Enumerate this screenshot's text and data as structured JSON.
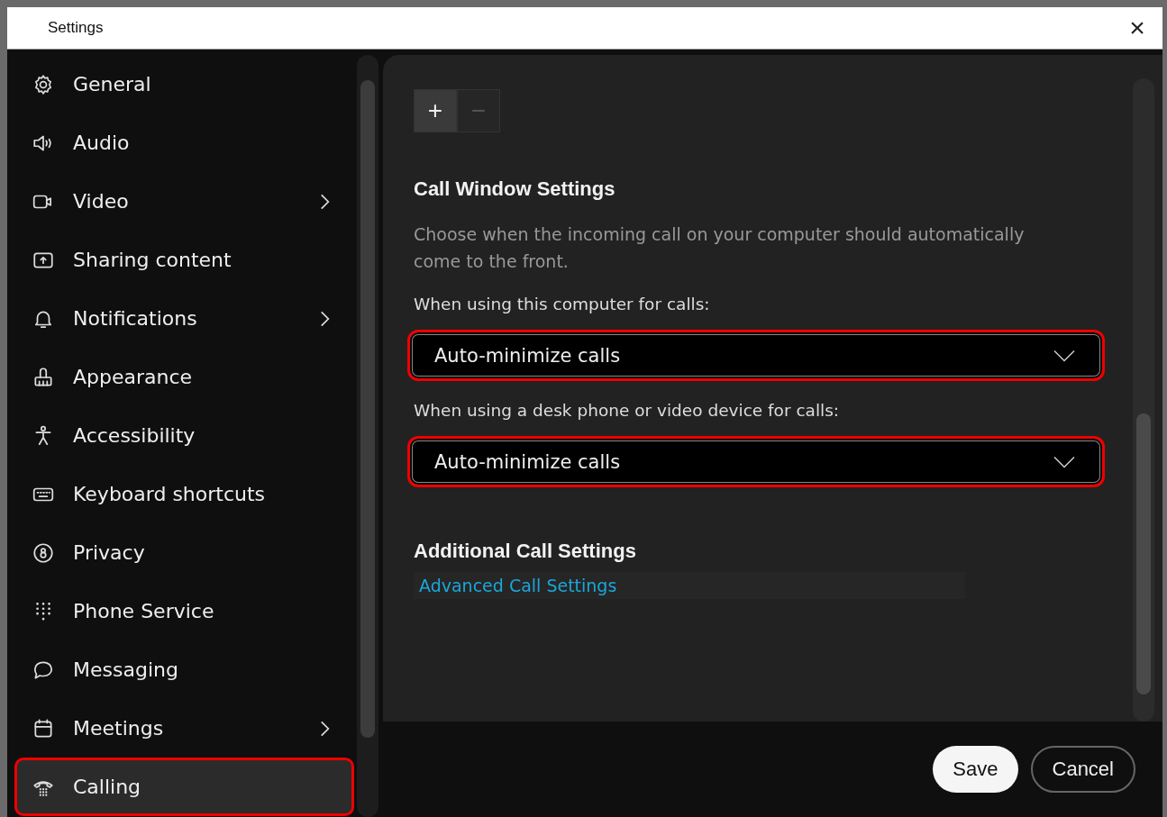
{
  "window": {
    "title": "Settings",
    "close": "×"
  },
  "sidebar": {
    "items": [
      {
        "label": "General",
        "kind": "gear",
        "submenu": false,
        "selected": false,
        "highlighted": false
      },
      {
        "label": "Audio",
        "kind": "speaker",
        "submenu": false,
        "selected": false,
        "highlighted": false
      },
      {
        "label": "Video",
        "kind": "camera",
        "submenu": true,
        "selected": false,
        "highlighted": false
      },
      {
        "label": "Sharing content",
        "kind": "share",
        "submenu": false,
        "selected": false,
        "highlighted": false
      },
      {
        "label": "Notifications",
        "kind": "bell",
        "submenu": true,
        "selected": false,
        "highlighted": false
      },
      {
        "label": "Appearance",
        "kind": "brush",
        "submenu": false,
        "selected": false,
        "highlighted": false
      },
      {
        "label": "Accessibility",
        "kind": "person",
        "submenu": false,
        "selected": false,
        "highlighted": false
      },
      {
        "label": "Keyboard shortcuts",
        "kind": "keyboard",
        "submenu": false,
        "selected": false,
        "highlighted": false
      },
      {
        "label": "Privacy",
        "kind": "privacy",
        "submenu": false,
        "selected": false,
        "highlighted": false
      },
      {
        "label": "Phone Service",
        "kind": "dialpad",
        "submenu": false,
        "selected": false,
        "highlighted": false
      },
      {
        "label": "Messaging",
        "kind": "chat",
        "submenu": false,
        "selected": false,
        "highlighted": false
      },
      {
        "label": "Meetings",
        "kind": "calendar",
        "submenu": true,
        "selected": false,
        "highlighted": false
      },
      {
        "label": "Calling",
        "kind": "phone",
        "submenu": false,
        "selected": true,
        "highlighted": true
      }
    ]
  },
  "zoom": {
    "plus": "+",
    "minus": "−",
    "minus_disabled": true
  },
  "call_window": {
    "heading": "Call Window Settings",
    "description": "Choose when the incoming call on your computer should automatically come to the front.",
    "fields": [
      {
        "label": "When using this computer for calls:",
        "value": "Auto-minimize calls",
        "highlighted": true
      },
      {
        "label": "When using a desk phone or video device for calls:",
        "value": "Auto-minimize calls",
        "highlighted": true
      }
    ]
  },
  "additional": {
    "heading": "Additional Call Settings",
    "link": "Advanced Call Settings"
  },
  "buttons": [
    {
      "label": "Save",
      "kind": "primary"
    },
    {
      "label": "Cancel",
      "kind": "secondary"
    }
  ]
}
